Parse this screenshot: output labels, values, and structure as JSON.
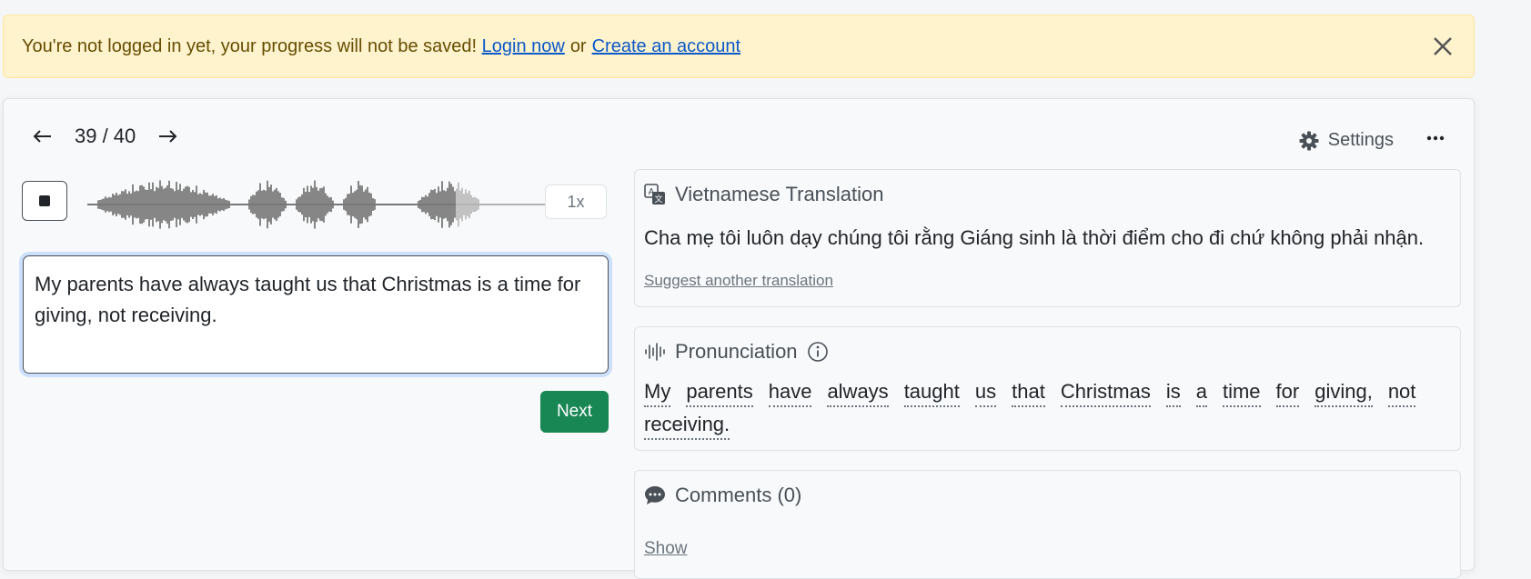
{
  "alert": {
    "message": "You're not logged in yet, your progress will not be saved!",
    "login_link": "Login now",
    "or_text": "or",
    "create_link": "Create an account",
    "close_icon": "close-icon"
  },
  "nav": {
    "prev_icon": "arrow-left-icon",
    "counter": "39 / 40",
    "next_icon": "arrow-right-icon",
    "settings_label": "Settings",
    "settings_icon": "gear-icon",
    "more_icon": "ellipsis-icon"
  },
  "player": {
    "stop_icon": "stop-icon",
    "playback_progress": 0.78,
    "speed_label": "1x"
  },
  "answer": {
    "value": "My parents have always taught us that Christmas is a time for giving, not receiving."
  },
  "next_button": "Next",
  "translation": {
    "icon": "translate-icon",
    "title": "Vietnamese Translation",
    "text": "Cha mẹ tôi luôn dạy chúng tôi rằng Giáng sinh là thời điểm cho đi chứ không phải nhận.",
    "suggest_link": "Suggest another translation"
  },
  "pronunciation": {
    "icon": "soundwave-icon",
    "title": "Pronunciation",
    "info_icon": "info-icon",
    "words": [
      "My",
      "parents",
      "have",
      "always",
      "taught",
      "us",
      "that",
      "Christmas",
      "is",
      "a",
      "time",
      "for",
      "giving,",
      "not",
      "receiving."
    ]
  },
  "comments": {
    "icon": "chat-icon",
    "title": "Comments (0)",
    "show_link": "Show"
  },
  "colors": {
    "alert_bg": "#fff3cd",
    "link": "#0a58ca",
    "next_button": "#198754",
    "waveform_played": "#555555",
    "waveform_unplayed": "#aaaaaa"
  }
}
